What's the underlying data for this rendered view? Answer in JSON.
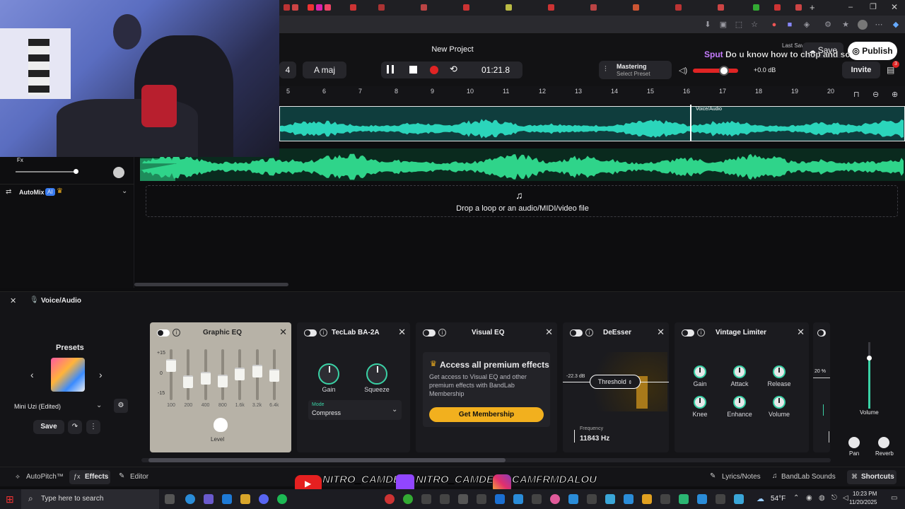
{
  "project": {
    "title": "New Project",
    "last_saved": "Last Saved",
    "save_label": "Save",
    "publish_label": "Publish",
    "invite_label": "Invite",
    "invite_badge": "3",
    "key_label": "A maj",
    "bpm_fragment": "4",
    "time": "01:21.8",
    "mastering_label": "Mastering",
    "mastering_sub": "Select Preset",
    "volume_db": "+0.0 dB",
    "master_volume": 0.6
  },
  "chat": {
    "user": "Sput",
    "message": "Do u know how to chop and sc"
  },
  "ruler": [
    "5",
    "6",
    "7",
    "8",
    "9",
    "10",
    "11",
    "12",
    "13",
    "14",
    "15",
    "16",
    "17",
    "18",
    "19",
    "20"
  ],
  "tracks": {
    "clip_label": "Voice/Audio",
    "drop_text": "Drop a loop or an audio/MIDI/video file"
  },
  "left_panel": {
    "fx_label": "Fx",
    "automix_label": "AutoMix",
    "automix_badge": "AI"
  },
  "fx_panel": {
    "track_name": "Voice/Audio",
    "presets_label": "Presets",
    "preset_name": "Mini Uzi (Edited)",
    "save_label": "Save"
  },
  "graphic_eq": {
    "title": "Graphic EQ",
    "db_labels": [
      "+15",
      "0",
      "-15"
    ],
    "bands": [
      "100",
      "200",
      "400",
      "800",
      "1.6k",
      "3.2k",
      "6.4k"
    ],
    "band_levels": [
      0.78,
      0.4,
      0.48,
      0.42,
      0.58,
      0.65,
      0.55
    ],
    "level_label": "Level"
  },
  "teclab": {
    "title": "TecLab BA-2A",
    "gain_label": "Gain",
    "squeeze_label": "Squeeze",
    "mode_label": "Mode",
    "mode_value": "Compress"
  },
  "visual_eq": {
    "title": "Visual EQ",
    "promo_title": "Access all premium effects",
    "promo_text": "Get access to Visual EQ and other premium effects with BandLab Membership",
    "cta": "Get Membership"
  },
  "deesser": {
    "title": "DeEsser",
    "db_value": "-22.3 dB",
    "threshold_label": "Threshold",
    "freq_label": "Frequency",
    "freq_value": "11843 Hz"
  },
  "vintage_limiter": {
    "title": "Vintage Limiter",
    "knobs": [
      "Gain",
      "Attack",
      "Release",
      "Knee",
      "Enhance",
      "Volume"
    ]
  },
  "mixer": {
    "percent": "20 %",
    "volume_label": "Volume",
    "pan_label": "Pan",
    "reverb_label": "Reverb"
  },
  "bottom_tabs": {
    "autopitch": "AutoPitch™",
    "effects": "Effects",
    "editor": "Editor",
    "lyrics": "Lyrics/Notes",
    "sounds": "BandLab Sounds",
    "shortcuts": "Shortcuts"
  },
  "socials": {
    "youtube": "NITRO_CAMDEN",
    "twitch": "NITRO_CAMDEN",
    "instagram": "CAMFRMDALOU"
  },
  "taskbar": {
    "search_placeholder": "Type here to search",
    "weather": "54°F",
    "time": "10:23 PM",
    "date": "11/20/2025"
  },
  "colors": {
    "accent_green": "#2fd48a",
    "accent_teal": "#3ad1a5",
    "record_red": "#e02424",
    "membership_gold": "#f2b01e"
  }
}
